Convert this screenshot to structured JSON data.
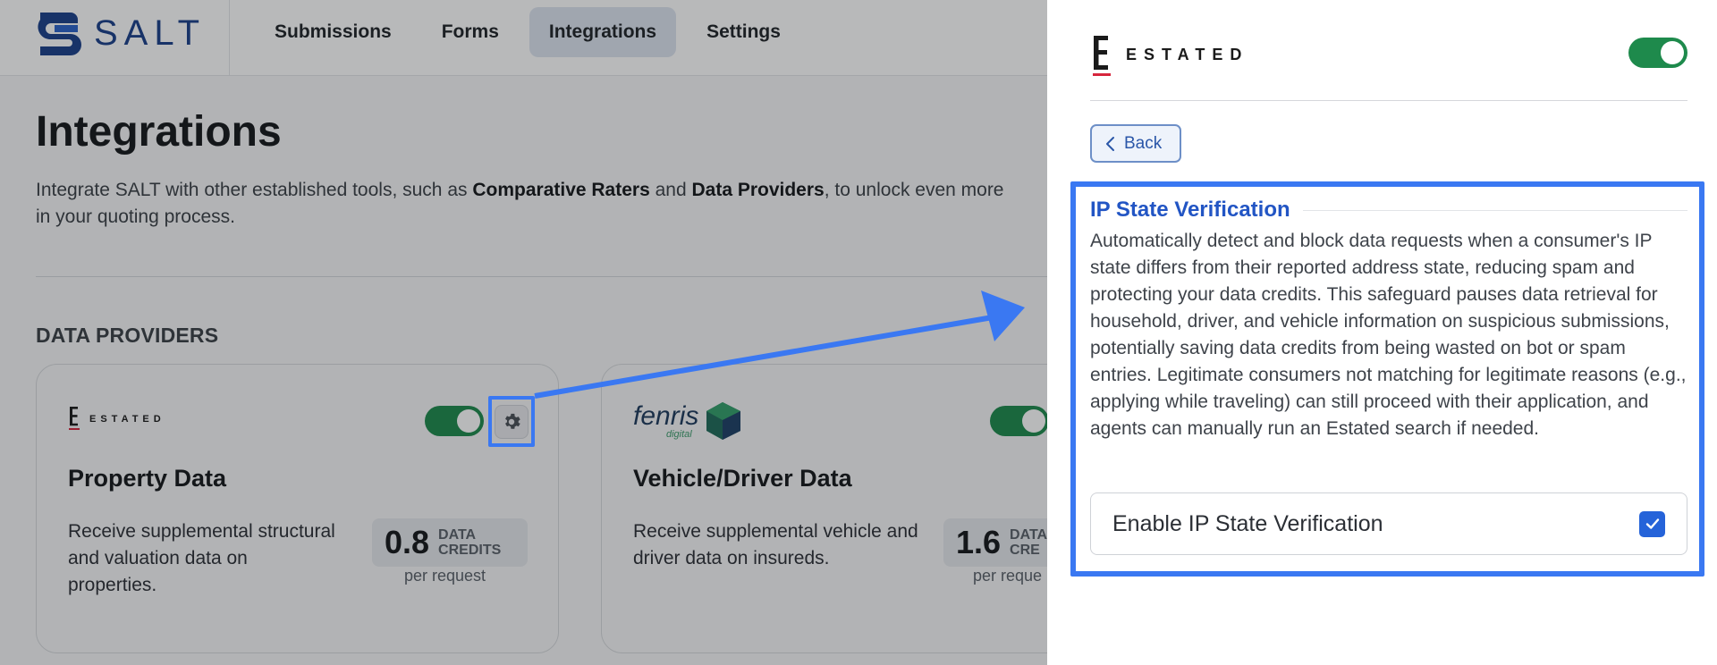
{
  "nav": {
    "logo_text": "SALT",
    "items": [
      {
        "label": "Submissions",
        "active": false
      },
      {
        "label": "Forms",
        "active": false
      },
      {
        "label": "Integrations",
        "active": true
      },
      {
        "label": "Settings",
        "active": false
      }
    ]
  },
  "page": {
    "title": "Integrations",
    "description_parts": {
      "p1": "Integrate SALT with other established tools, such as ",
      "b1": "Comparative Raters",
      "p2": " and ",
      "b2": "Data Providers",
      "p3": ", to unlock even more",
      "p4": "in your quoting process."
    },
    "section_label": "DATA PROVIDERS"
  },
  "cards": [
    {
      "provider": "ESTATED",
      "title": "Property Data",
      "description": "Receive supplemental structural and valuation data on properties.",
      "credits_value": "0.8",
      "credits_unit_line1": "DATA",
      "credits_unit_line2": "CREDITS",
      "per_request": "per request",
      "enabled": true
    },
    {
      "provider": "fenris",
      "provider_sub": "digital",
      "title": "Vehicle/Driver Data",
      "description": "Receive supplemental vehicle and driver data on insureds.",
      "credits_value": "1.6",
      "credits_unit_line1": "DATA",
      "credits_unit_line2": "CRE",
      "per_request": "per reque",
      "enabled": true
    }
  ],
  "drawer": {
    "provider": "ESTATED",
    "enabled": true,
    "back_label": "Back",
    "section_title": "IP State Verification",
    "section_text": "Automatically detect and block data requests when a consumer's IP state differs from their reported address state, reducing spam and protecting your data credits. This safeguard pauses data retrieval for household, driver, and vehicle information on suspicious submissions, potentially saving data credits from being wasted on bot or spam entries. Legitimate consumers not matching for legitimate reasons (e.g., applying while traveling) can still proceed with their application, and agents can manually run an Estated search if needed.",
    "option_label": "Enable IP State Verification",
    "option_checked": true
  },
  "colors": {
    "brand": "#1a3f8a",
    "toggle_on": "#1e8a4c",
    "accent": "#3a78f2",
    "link": "#2255c4"
  }
}
